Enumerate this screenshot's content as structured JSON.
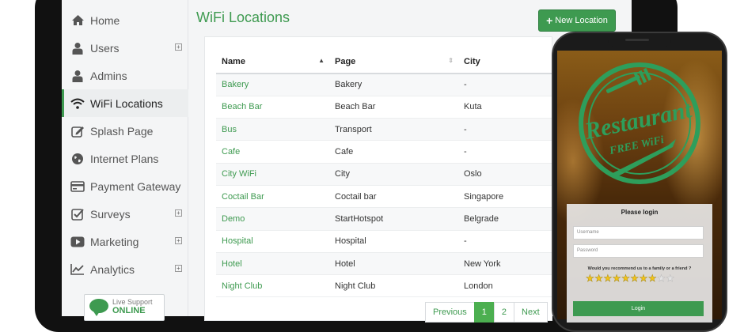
{
  "sidebar": {
    "items": [
      {
        "label": "Home",
        "icon": "home-icon",
        "expandable": false
      },
      {
        "label": "Users",
        "icon": "user-icon",
        "expandable": true
      },
      {
        "label": "Admins",
        "icon": "user-icon",
        "expandable": false
      },
      {
        "label": "WiFi Locations",
        "icon": "wifi-icon",
        "expandable": false,
        "active": true
      },
      {
        "label": "Splash Page",
        "icon": "edit-icon",
        "expandable": false
      },
      {
        "label": "Internet Plans",
        "icon": "globe-icon",
        "expandable": false
      },
      {
        "label": "Payment Gateway",
        "icon": "credit-card-icon",
        "expandable": false
      },
      {
        "label": "Surveys",
        "icon": "checkbox-icon",
        "expandable": true
      },
      {
        "label": "Marketing",
        "icon": "play-icon",
        "expandable": true
      },
      {
        "label": "Analytics",
        "icon": "chart-icon",
        "expandable": true
      }
    ],
    "live_support": {
      "line1": "Live Support",
      "line2": "ONLINE"
    }
  },
  "main": {
    "title": "WiFi Locations",
    "new_button": "New Location",
    "table": {
      "columns": [
        "Name",
        "Page",
        "City"
      ],
      "rows": [
        [
          "Bakery",
          "Bakery",
          "-"
        ],
        [
          "Beach Bar",
          "Beach Bar",
          "Kuta"
        ],
        [
          "Bus",
          "Transport",
          "-"
        ],
        [
          "Cafe",
          "Cafe",
          "-"
        ],
        [
          "City WiFi",
          "City",
          "Oslo"
        ],
        [
          "Coctail Bar",
          "Coctail bar",
          "Singapore"
        ],
        [
          "Demo",
          "StartHotspot",
          "Belgrade"
        ],
        [
          "Hospital",
          "Hospital",
          "-"
        ],
        [
          "Hotel",
          "Hotel",
          "New York"
        ],
        [
          "Night Club",
          "Night Club",
          "London"
        ]
      ]
    },
    "pagination": {
      "previous": "Previous",
      "pages": [
        "1",
        "2"
      ],
      "current": "1",
      "next": "Next"
    }
  },
  "phone": {
    "logo_line1": "Restaurant",
    "logo_line2": "FREE WiFi",
    "please_login": "Please login",
    "username_placeholder": "Username",
    "password_placeholder": "Password",
    "recommend_question": "Would you recommend us to a family or a friend ?",
    "stars_total": 10,
    "stars_filled": 8,
    "login_button": "Login"
  },
  "colors": {
    "accent": "#3e9a50",
    "logo": "#2e9e5b"
  }
}
